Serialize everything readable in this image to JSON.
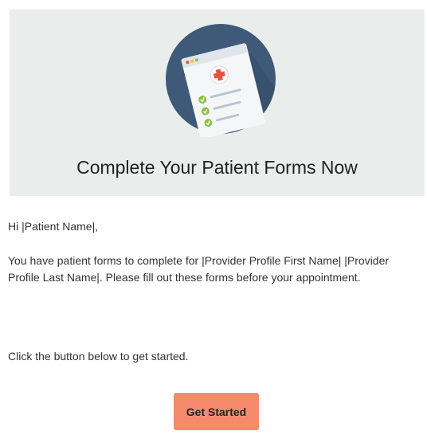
{
  "hero": {
    "title": "Complete Your Patient Forms Now",
    "illustration_icon": "patient-form-clipboard-icon"
  },
  "body": {
    "greeting": "Hi |Patient Name|,",
    "intro": "You have patient forms to complete for |Provider Profile First Name| |Provider Profile Last Name|. Please fill out these forms before your appointment.",
    "cta_text": "Click the button below to get started."
  },
  "cta_button": {
    "label": "Get Started"
  },
  "colors": {
    "hero_background": "#e9eeed",
    "illustration_circle": "#3f5a78",
    "button_background": "#f58b6c",
    "checkmark": "#8bc34a",
    "medical_cross": "#e8533f"
  }
}
